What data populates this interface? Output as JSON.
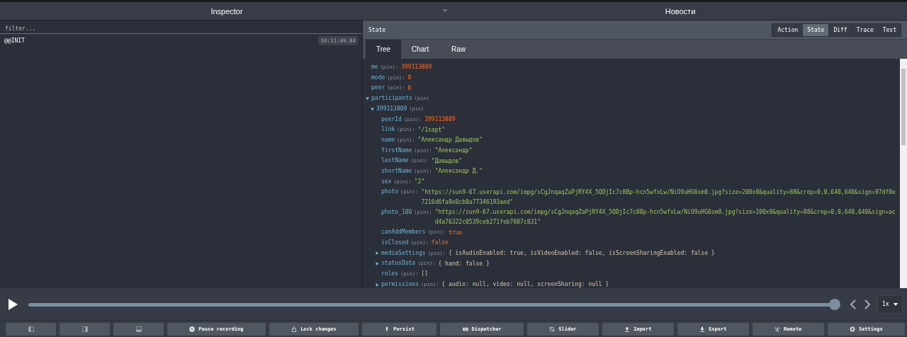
{
  "top_bar": {
    "monitor_select": "Inspector",
    "instance_select": "Новости"
  },
  "action_list": {
    "filter_placeholder": "filter...",
    "actions": [
      {
        "name": "@@INIT",
        "time": "10:11:49.84",
        "selected": false
      }
    ]
  },
  "state_panel": {
    "title": "State",
    "monitor_buttons": [
      {
        "label": "Action",
        "selected": false
      },
      {
        "label": "State",
        "selected": true
      },
      {
        "label": "Diff",
        "selected": false
      },
      {
        "label": "Trace",
        "selected": false
      },
      {
        "label": "Test",
        "selected": false
      }
    ],
    "tabs": [
      {
        "label": "Tree",
        "selected": true
      },
      {
        "label": "Chart",
        "selected": false
      },
      {
        "label": "Raw",
        "selected": false
      }
    ],
    "tree": [
      {
        "key": "me",
        "pin": "(pin):",
        "value": "399113809",
        "kind": "number"
      },
      {
        "key": "mode",
        "pin": "(pin):",
        "value": "0",
        "kind": "number"
      },
      {
        "key": "peer",
        "pin": "(pin):",
        "value": "0",
        "kind": "number"
      },
      {
        "key": "participants",
        "pin": "(pin)",
        "kind": "object",
        "expanded": true,
        "children": [
          {
            "key": "399113809",
            "pin": "(pin)",
            "kind": "object",
            "expanded": true,
            "children": [
              {
                "key": "peerId",
                "pin": "(pin):",
                "value": "399113809",
                "kind": "number"
              },
              {
                "key": "link",
                "pin": "(pin):",
                "value": "\"/1sapt\"",
                "kind": "string"
              },
              {
                "key": "name",
                "pin": "(pin):",
                "value": "\"Александр Давыдов\"",
                "kind": "string"
              },
              {
                "key": "firstName",
                "pin": "(pin):",
                "value": "\"Александр\"",
                "kind": "string"
              },
              {
                "key": "lastName",
                "pin": "(pin):",
                "value": "\"Давыдов\"",
                "kind": "string"
              },
              {
                "key": "shortName",
                "pin": "(pin):",
                "value": "\"Александр Д.\"",
                "kind": "string"
              },
              {
                "key": "sex",
                "pin": "(pin):",
                "value": "\"2\"",
                "kind": "string"
              },
              {
                "key": "photo",
                "pin": "(pin):",
                "value": "\"https://sun9-67.userapi.com/impg/sCgJnqaqZaPjRY4X_5QDjIc7c8Bp-hcn5wfxLw/NiO9uHG6sm0.jpg?size=200x0&quality=88&crop=0,0,640,640&sign=97df0e7216d6fa8e0cb8a77346193aed\"",
                "kind": "string"
              },
              {
                "key": "photo_100",
                "pin": "(pin):",
                "value": "\"https://sun9-67.userapi.com/impg/sCgJnqaqZaPjRY4X_5QDjIc7c8Bp-hcn5wfxLw/NiO9uHG6sm0.jpg?size=100x0&quality=88&crop=0,0,640,640&sign=acd4a76322c0539ceb271feb7887c831\"",
                "kind": "string"
              },
              {
                "key": "canAddMembers",
                "pin": "(pin):",
                "value": "true",
                "kind": "number"
              },
              {
                "key": "isClosed",
                "pin": "(pin):",
                "value": "false",
                "kind": "number"
              },
              {
                "key": "mediaSettings",
                "pin": "(pin):",
                "value": "{ isAudioEnabled: true, isVideoEnabled: false, isScreenSharingEnabled: false }",
                "kind": "summary",
                "expanded": false
              },
              {
                "key": "statusData",
                "pin": "(pin):",
                "value": "{ hand: false }",
                "kind": "summary",
                "expanded": false
              },
              {
                "key": "roles",
                "pin": "(pin):",
                "value": "[]",
                "kind": "summary"
              },
              {
                "key": "permissions",
                "pin": "(pin):",
                "value": "{ audio: null, video: null, screenSharing: null }",
                "kind": "summary",
                "expanded": false
              }
            ]
          }
        ]
      }
    ]
  },
  "timeline": {
    "level": 1.0,
    "speed": "1x"
  },
  "toolbar": [
    {
      "kind": "icon"
    },
    {
      "kind": "icon"
    },
    {
      "kind": "icon"
    },
    {
      "kind": "labeled",
      "label": "Pause recording"
    },
    {
      "kind": "labeled",
      "label": "Lock changes"
    },
    {
      "kind": "labeled",
      "label": "Persist"
    },
    {
      "kind": "labeled",
      "label": "Dispatcher"
    },
    {
      "kind": "labeled",
      "label": "Slider"
    },
    {
      "kind": "labeled",
      "label": "Import"
    },
    {
      "kind": "labeled",
      "label": "Export"
    },
    {
      "kind": "labeled",
      "label": "Remote"
    },
    {
      "kind": "labeled",
      "label": "Settings"
    }
  ]
}
